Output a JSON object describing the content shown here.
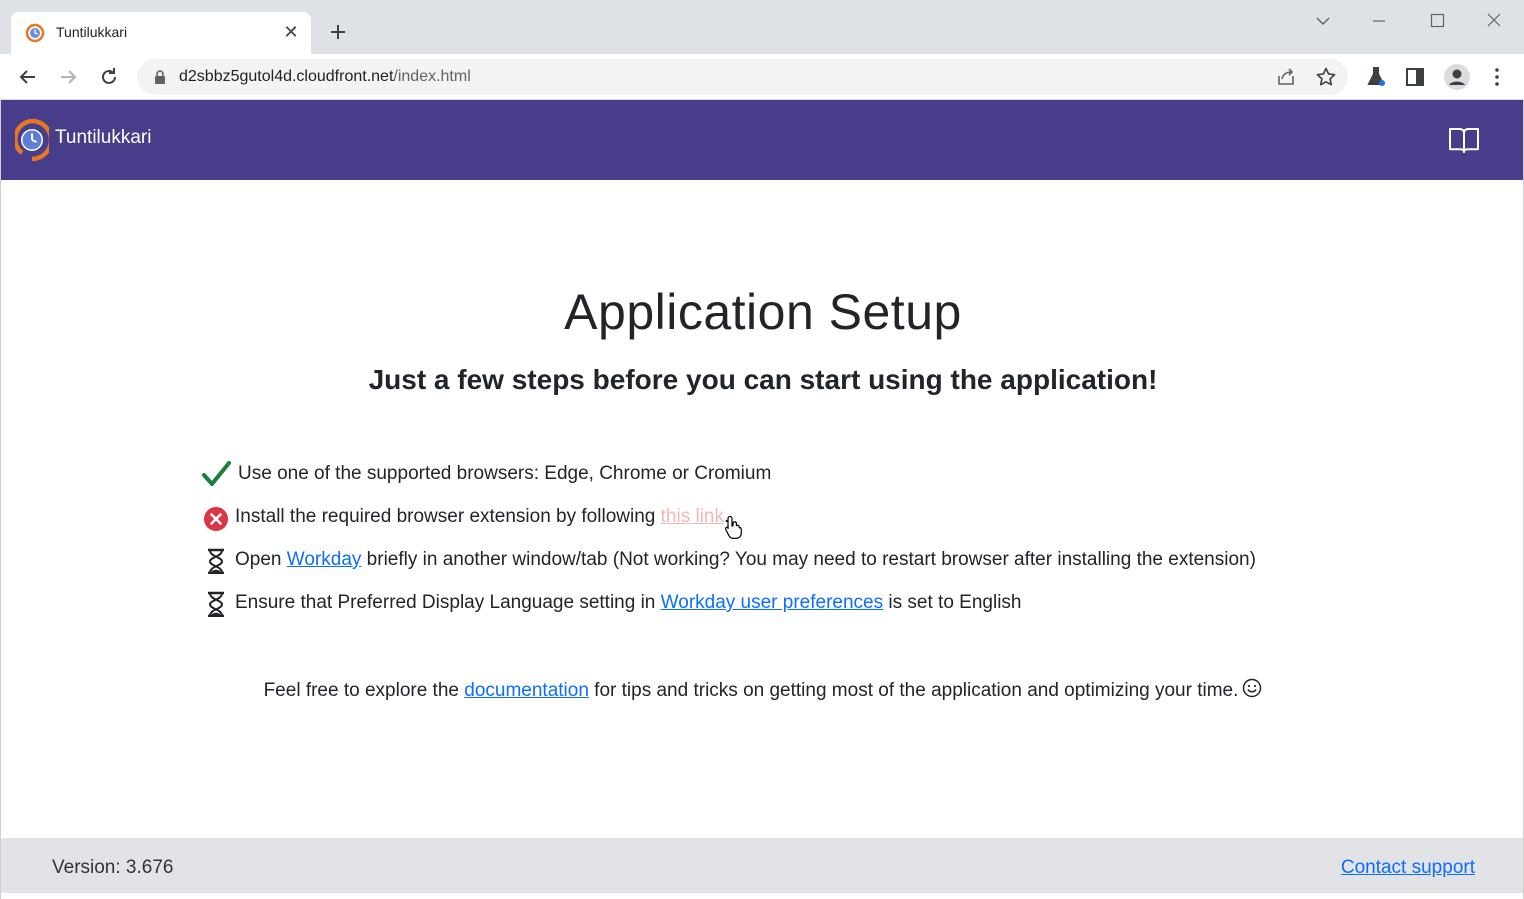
{
  "browser": {
    "tab_title": "Tuntilukkari",
    "tab_close": "✕",
    "url_host": "d2sbbz5gutol4d.cloudfront.net",
    "url_path": "/index.html"
  },
  "app": {
    "brand": "Tuntilukkari",
    "colors": {
      "header": "#483d8b",
      "accent_orange": "#e87722",
      "link": "#0d6efd",
      "success": "#1a7f3c",
      "error": "#dc3545"
    }
  },
  "setup": {
    "title": "Application Setup",
    "subtitle": "Just a few steps before you can start using the application!",
    "steps": [
      {
        "status": "done-check-icon",
        "text": "Use one of the supported browsers: Edge, Chrome or Cromium"
      },
      {
        "status": "error-icon",
        "before": "Install the required browser extension by following ",
        "link": "this link",
        "after": "."
      },
      {
        "status": "hourglass-icon",
        "before": "Open ",
        "link": "Workday",
        "after": " briefly in another window/tab (Not working? You may need to restart browser after installing the extension)"
      },
      {
        "status": "hourglass-icon",
        "before": "Ensure that Preferred Display Language setting in ",
        "link": "Workday user preferences",
        "after": " is set to English"
      }
    ],
    "explore_before": "Feel free to explore the ",
    "explore_link": "documentation",
    "explore_after": " for tips and tricks on getting most of the application and optimizing your time."
  },
  "footer": {
    "version": "Version: 3.676",
    "contact": "Contact support"
  }
}
